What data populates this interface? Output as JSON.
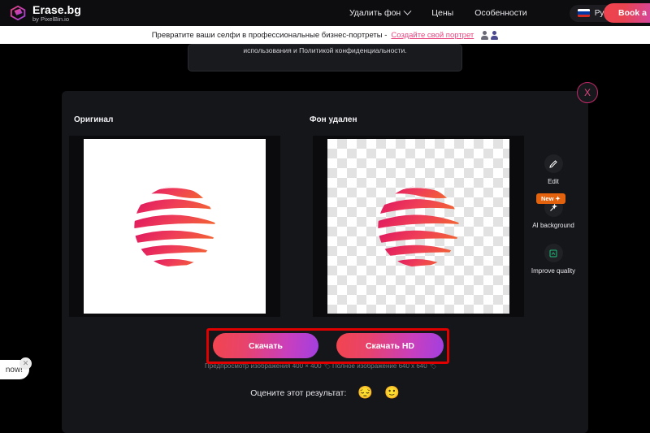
{
  "header": {
    "brand_title": "Erase.bg",
    "brand_subtitle": "by PixelBin.io",
    "brand_logo_icon": "erasebg-cube-logo",
    "nav": [
      {
        "label": "Удалить фон",
        "has_dropdown": true
      },
      {
        "label": "Цены",
        "has_dropdown": false
      },
      {
        "label": "Особенности",
        "has_dropdown": false
      }
    ],
    "language": {
      "label": "Русский",
      "flag_icon": "russia-flag-icon",
      "chevron_icon": "chevron-down-icon"
    },
    "cta": {
      "label": "Book a"
    }
  },
  "banner": {
    "text": "Превратите ваши селфи в профессиональные бизнес-портреты -",
    "link": "Создайте свой портрет",
    "avatar_icons": [
      "avatar-icon-1",
      "avatar-icon-2"
    ]
  },
  "remnant_dialog": {
    "text": "использования и Политикой конфиденциальности."
  },
  "result_panel": {
    "close_icon": "close-icon",
    "close_label": "X",
    "original_label": "Оригинал",
    "removed_label": "Фон удален",
    "original_image_alt": "globe-logo-on-white",
    "removed_image_alt": "globe-logo-transparent"
  },
  "tools": [
    {
      "label": "Edit",
      "icon": "pencil-icon",
      "badge": null
    },
    {
      "label": "AI background",
      "icon": "magic-wand-icon",
      "badge": "New"
    },
    {
      "label": "Improve quality",
      "icon": "enhance-image-icon",
      "badge": null
    }
  ],
  "downloads": {
    "standard_label": "Скачать",
    "hd_label": "Скачать HD",
    "standard_note": "Предпросмотр изображения 400 × 400",
    "hd_note": "Полное изображение 640 x 640",
    "note_tag": "🏷"
  },
  "rating": {
    "label": "Оцените этот результат:",
    "options": [
      "😔",
      "🙂"
    ]
  },
  "toast": {
    "text": "now!",
    "close_icon": "close-icon",
    "close_label": "✕"
  },
  "colors": {
    "accent_pink": "#e8447f",
    "gradient_start": "#f2454f",
    "gradient_end": "#a23fe0",
    "badge_orange": "#e2620e",
    "highlight_red": "#e00000",
    "panel_bg": "#151619"
  }
}
